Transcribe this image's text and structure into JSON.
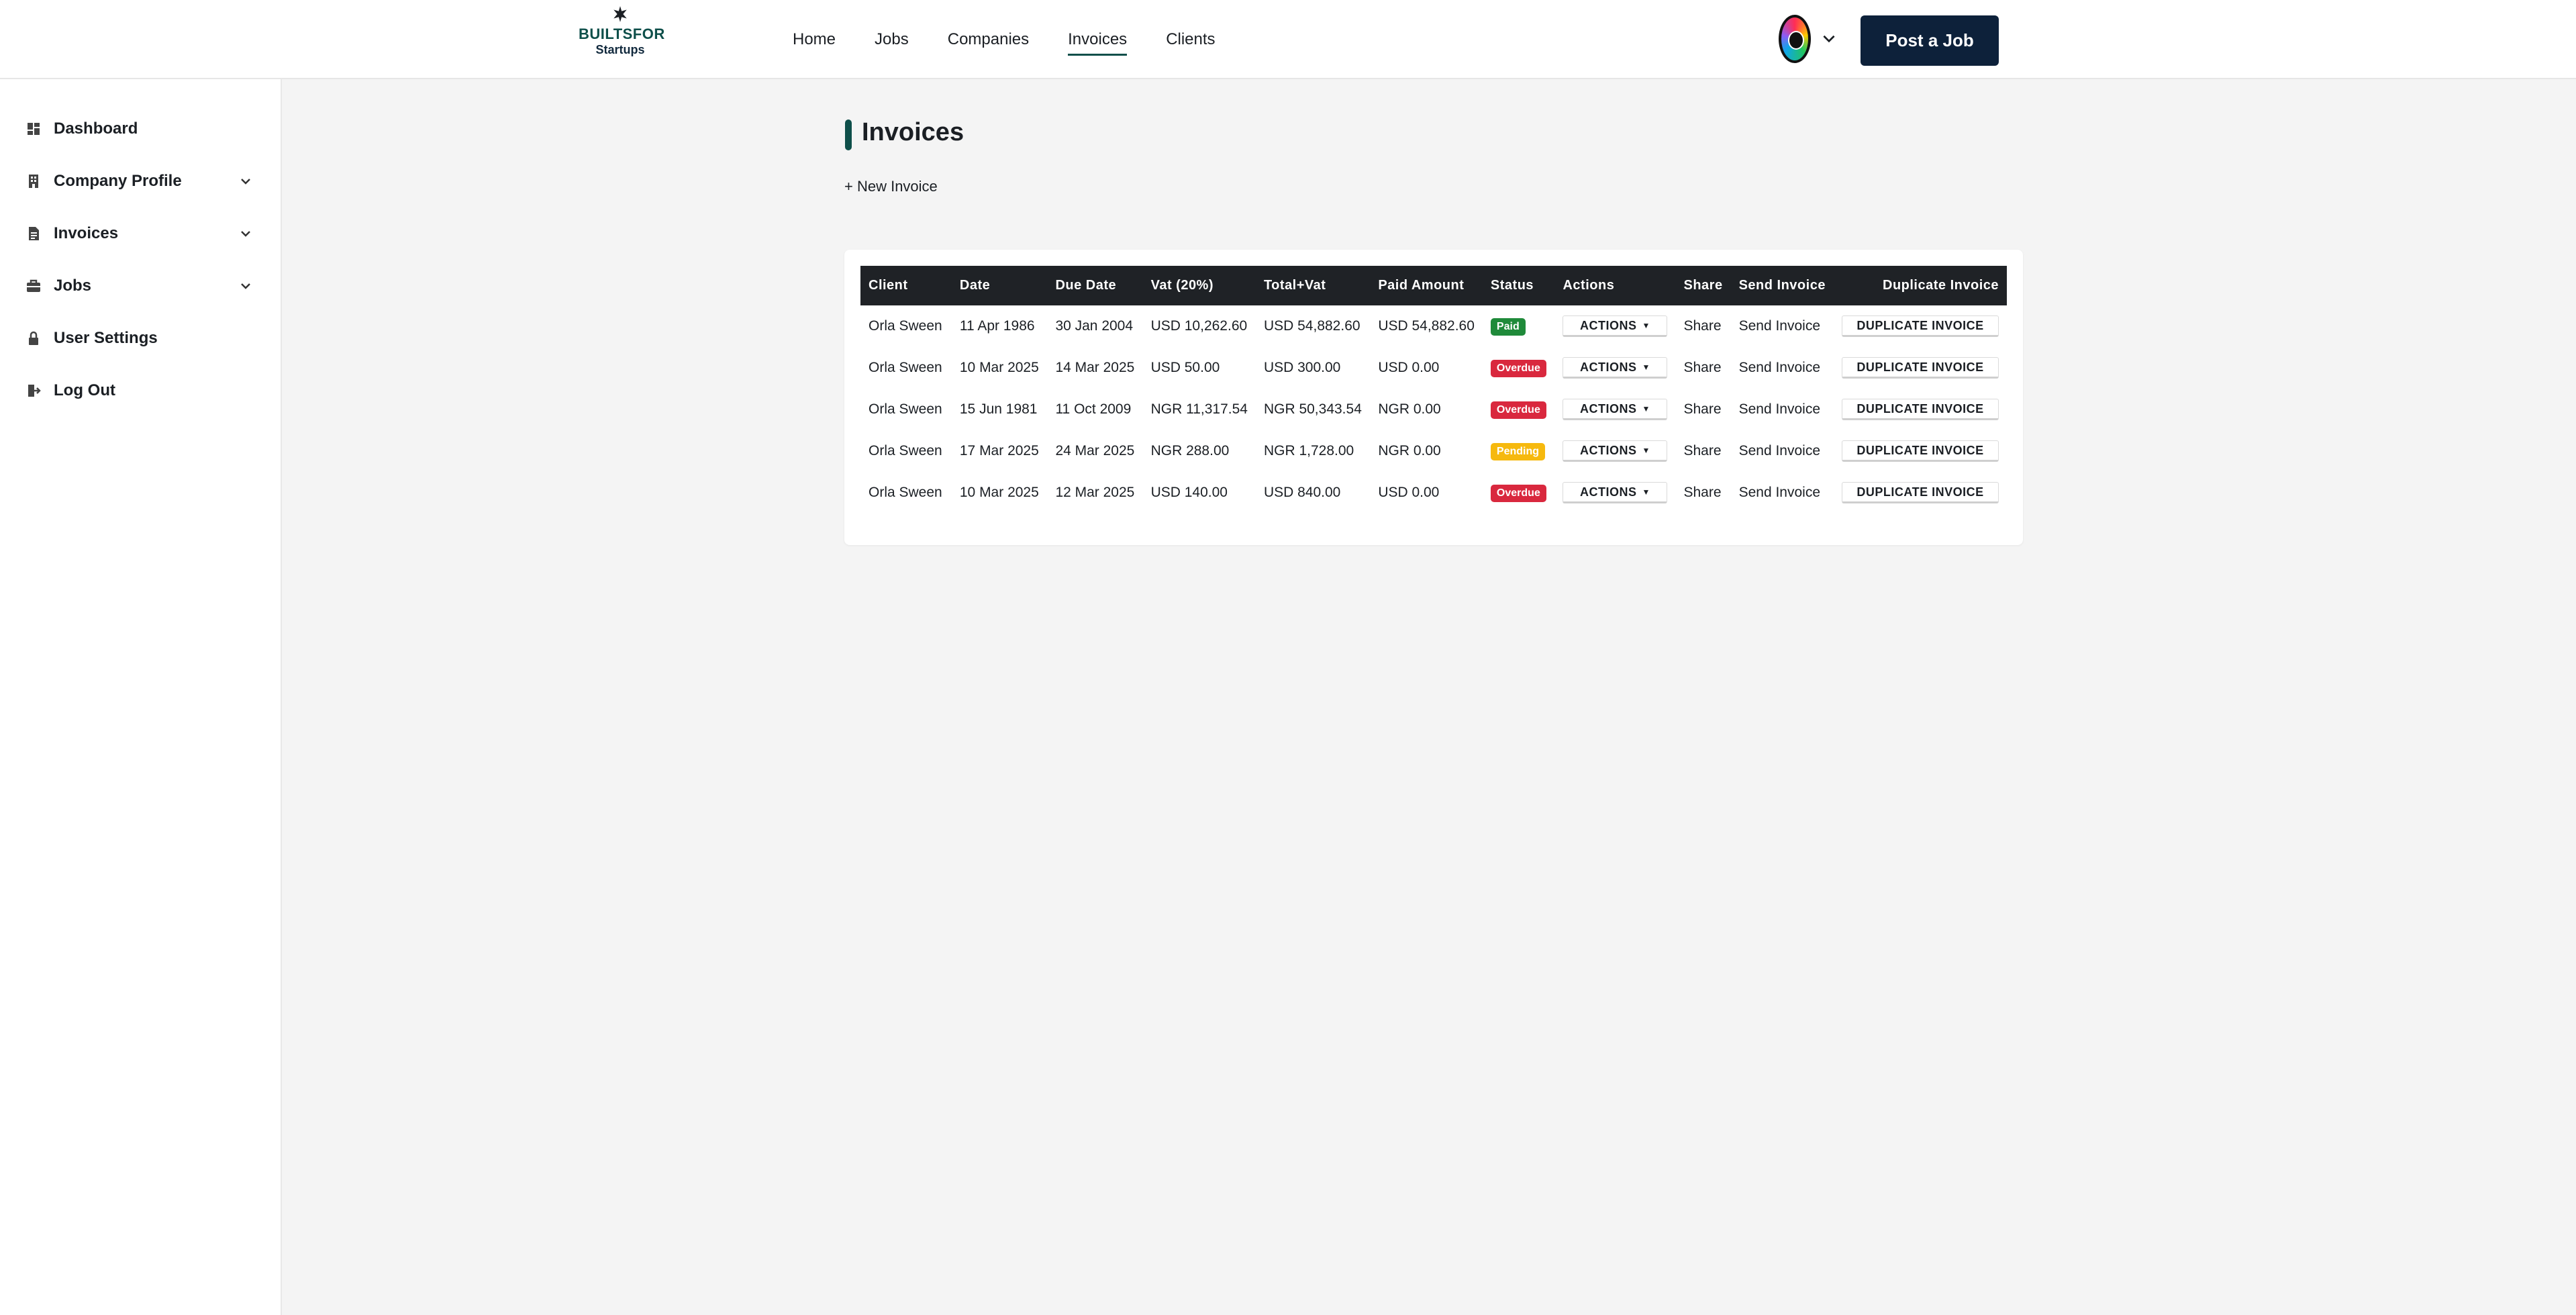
{
  "brand": {
    "line1": "BUILTSFOR",
    "line2": "Startups"
  },
  "nav": {
    "items": [
      {
        "label": "Home",
        "active": false
      },
      {
        "label": "Jobs",
        "active": false
      },
      {
        "label": "Companies",
        "active": false
      },
      {
        "label": "Invoices",
        "active": true
      },
      {
        "label": "Clients",
        "active": false
      }
    ],
    "post_job_label": "Post a Job"
  },
  "sidebar": {
    "items": [
      {
        "label": "Dashboard",
        "icon": "dashboard-icon",
        "expandable": false
      },
      {
        "label": "Company Profile",
        "icon": "building-icon",
        "expandable": true
      },
      {
        "label": "Invoices",
        "icon": "document-icon",
        "expandable": true
      },
      {
        "label": "Jobs",
        "icon": "briefcase-icon",
        "expandable": true
      },
      {
        "label": "User Settings",
        "icon": "lock-icon",
        "expandable": false
      },
      {
        "label": "Log Out",
        "icon": "logout-icon",
        "expandable": false
      }
    ]
  },
  "page": {
    "title": "Invoices",
    "new_invoice_label": "+ New Invoice"
  },
  "table": {
    "headers": [
      "Client",
      "Date",
      "Due Date",
      "Vat (20%)",
      "Total+Vat",
      "Paid Amount",
      "Status",
      "Actions",
      "Share",
      "Send Invoice",
      "Duplicate Invoice"
    ],
    "actions_label": "ACTIONS",
    "share_label": "Share",
    "send_label": "Send Invoice",
    "duplicate_label": "DUPLICATE INVOICE",
    "rows": [
      {
        "client": "Orla Sween",
        "date": "11 Apr 1986",
        "due": "30 Jan 2004",
        "vat": "USD 10,262.60",
        "total": "USD 54,882.60",
        "paid": "USD 54,882.60",
        "status": "Paid"
      },
      {
        "client": "Orla Sween",
        "date": "10 Mar 2025",
        "due": "14 Mar 2025",
        "vat": "USD 50.00",
        "total": "USD 300.00",
        "paid": "USD 0.00",
        "status": "Overdue"
      },
      {
        "client": "Orla Sween",
        "date": "15 Jun 1981",
        "due": "11 Oct 2009",
        "vat": "NGR 11,317.54",
        "total": "NGR 50,343.54",
        "paid": "NGR 0.00",
        "status": "Overdue"
      },
      {
        "client": "Orla Sween",
        "date": "17 Mar 2025",
        "due": "24 Mar 2025",
        "vat": "NGR 288.00",
        "total": "NGR 1,728.00",
        "paid": "NGR 0.00",
        "status": "Pending"
      },
      {
        "client": "Orla Sween",
        "date": "10 Mar 2025",
        "due": "12 Mar 2025",
        "vat": "USD 140.00",
        "total": "USD 840.00",
        "paid": "USD 0.00",
        "status": "Overdue"
      }
    ]
  },
  "colors": {
    "brand_dark": "#0d213a",
    "brand_teal": "#0e4f4a",
    "status_paid": "#1f8a3a",
    "status_overdue": "#d9283e",
    "status_pending": "#f6b90e",
    "table_header": "#1f2226"
  }
}
